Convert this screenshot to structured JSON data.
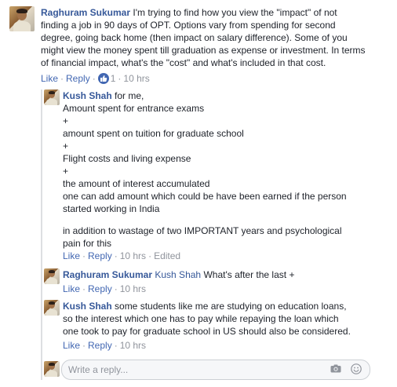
{
  "comments": [
    {
      "author": "Raghuram Sukumar",
      "lines": [
        "I'm trying to find how you view the \"impact\" of not",
        "finding a job in 90 days of OPT. Options vary from spending for second",
        "degree, going back home (then impact on salary difference). Some of you",
        "might view the money spent till graduation as expense or investment. In terms",
        "of financial impact, what's the \"cost\" and what's included in that cost."
      ],
      "actions": {
        "like": "Like",
        "reply": "Reply",
        "reaction_count": "1",
        "time": "10 hrs"
      }
    }
  ],
  "replies": [
    {
      "author": "Kush Shah",
      "lines": [
        "for me,",
        "Amount spent for entrance exams",
        "+",
        "amount spent on tuition for graduate school",
        "+",
        "Flight costs and living expense",
        "+",
        "the amount of interest accumulated",
        "one can add amount which could be have been earned if the person",
        "started working in India",
        "",
        "in addition to wastage of two IMPORTANT years and psychological",
        "pain for this"
      ],
      "actions": {
        "like": "Like",
        "reply": "Reply",
        "time": "10 hrs",
        "edited": "Edited"
      }
    },
    {
      "author": "Raghuram Sukumar",
      "mention": "Kush Shah",
      "lines": [
        "What's after the last +"
      ],
      "actions": {
        "like": "Like",
        "reply": "Reply",
        "time": "10 hrs"
      }
    },
    {
      "author": "Kush Shah",
      "lines": [
        "some students like me are studying on education loans,",
        "so the interest which one has to pay while repaying the loan which",
        "one took to pay for graduate school in US should also be considered."
      ],
      "actions": {
        "like": "Like",
        "reply": "Reply",
        "time": "10 hrs"
      }
    }
  ],
  "reply_box": {
    "placeholder": "Write a reply...",
    "camera_icon": "camera-icon",
    "smiley_icon": "smiley-icon"
  },
  "colors": {
    "link": "#365899",
    "action": "#4267b2",
    "meta": "#90949c",
    "text": "#1d2129"
  }
}
